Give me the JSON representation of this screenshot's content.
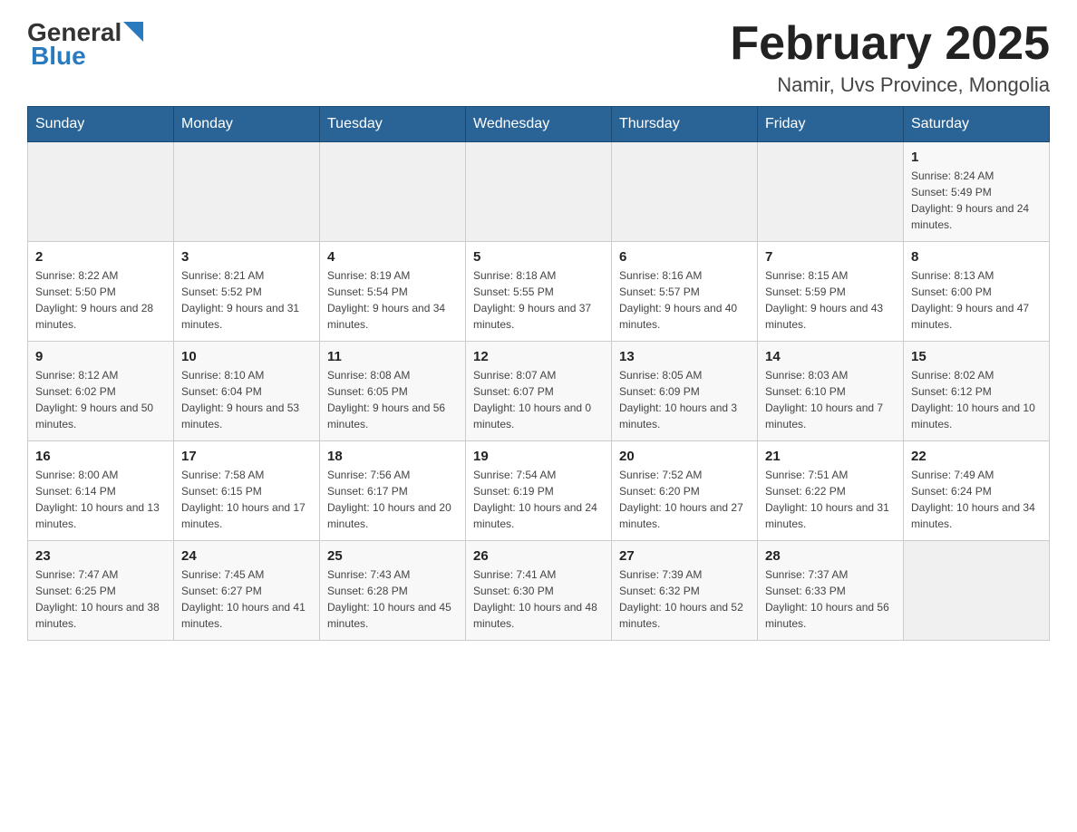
{
  "header": {
    "logo": {
      "general": "General",
      "arrow": "▶",
      "blue": "Blue"
    },
    "title": "February 2025",
    "location": "Namir, Uvs Province, Mongolia"
  },
  "weekdays": [
    "Sunday",
    "Monday",
    "Tuesday",
    "Wednesday",
    "Thursday",
    "Friday",
    "Saturday"
  ],
  "weeks": [
    [
      {
        "day": "",
        "info": ""
      },
      {
        "day": "",
        "info": ""
      },
      {
        "day": "",
        "info": ""
      },
      {
        "day": "",
        "info": ""
      },
      {
        "day": "",
        "info": ""
      },
      {
        "day": "",
        "info": ""
      },
      {
        "day": "1",
        "info": "Sunrise: 8:24 AM\nSunset: 5:49 PM\nDaylight: 9 hours and 24 minutes."
      }
    ],
    [
      {
        "day": "2",
        "info": "Sunrise: 8:22 AM\nSunset: 5:50 PM\nDaylight: 9 hours and 28 minutes."
      },
      {
        "day": "3",
        "info": "Sunrise: 8:21 AM\nSunset: 5:52 PM\nDaylight: 9 hours and 31 minutes."
      },
      {
        "day": "4",
        "info": "Sunrise: 8:19 AM\nSunset: 5:54 PM\nDaylight: 9 hours and 34 minutes."
      },
      {
        "day": "5",
        "info": "Sunrise: 8:18 AM\nSunset: 5:55 PM\nDaylight: 9 hours and 37 minutes."
      },
      {
        "day": "6",
        "info": "Sunrise: 8:16 AM\nSunset: 5:57 PM\nDaylight: 9 hours and 40 minutes."
      },
      {
        "day": "7",
        "info": "Sunrise: 8:15 AM\nSunset: 5:59 PM\nDaylight: 9 hours and 43 minutes."
      },
      {
        "day": "8",
        "info": "Sunrise: 8:13 AM\nSunset: 6:00 PM\nDaylight: 9 hours and 47 minutes."
      }
    ],
    [
      {
        "day": "9",
        "info": "Sunrise: 8:12 AM\nSunset: 6:02 PM\nDaylight: 9 hours and 50 minutes."
      },
      {
        "day": "10",
        "info": "Sunrise: 8:10 AM\nSunset: 6:04 PM\nDaylight: 9 hours and 53 minutes."
      },
      {
        "day": "11",
        "info": "Sunrise: 8:08 AM\nSunset: 6:05 PM\nDaylight: 9 hours and 56 minutes."
      },
      {
        "day": "12",
        "info": "Sunrise: 8:07 AM\nSunset: 6:07 PM\nDaylight: 10 hours and 0 minutes."
      },
      {
        "day": "13",
        "info": "Sunrise: 8:05 AM\nSunset: 6:09 PM\nDaylight: 10 hours and 3 minutes."
      },
      {
        "day": "14",
        "info": "Sunrise: 8:03 AM\nSunset: 6:10 PM\nDaylight: 10 hours and 7 minutes."
      },
      {
        "day": "15",
        "info": "Sunrise: 8:02 AM\nSunset: 6:12 PM\nDaylight: 10 hours and 10 minutes."
      }
    ],
    [
      {
        "day": "16",
        "info": "Sunrise: 8:00 AM\nSunset: 6:14 PM\nDaylight: 10 hours and 13 minutes."
      },
      {
        "day": "17",
        "info": "Sunrise: 7:58 AM\nSunset: 6:15 PM\nDaylight: 10 hours and 17 minutes."
      },
      {
        "day": "18",
        "info": "Sunrise: 7:56 AM\nSunset: 6:17 PM\nDaylight: 10 hours and 20 minutes."
      },
      {
        "day": "19",
        "info": "Sunrise: 7:54 AM\nSunset: 6:19 PM\nDaylight: 10 hours and 24 minutes."
      },
      {
        "day": "20",
        "info": "Sunrise: 7:52 AM\nSunset: 6:20 PM\nDaylight: 10 hours and 27 minutes."
      },
      {
        "day": "21",
        "info": "Sunrise: 7:51 AM\nSunset: 6:22 PM\nDaylight: 10 hours and 31 minutes."
      },
      {
        "day": "22",
        "info": "Sunrise: 7:49 AM\nSunset: 6:24 PM\nDaylight: 10 hours and 34 minutes."
      }
    ],
    [
      {
        "day": "23",
        "info": "Sunrise: 7:47 AM\nSunset: 6:25 PM\nDaylight: 10 hours and 38 minutes."
      },
      {
        "day": "24",
        "info": "Sunrise: 7:45 AM\nSunset: 6:27 PM\nDaylight: 10 hours and 41 minutes."
      },
      {
        "day": "25",
        "info": "Sunrise: 7:43 AM\nSunset: 6:28 PM\nDaylight: 10 hours and 45 minutes."
      },
      {
        "day": "26",
        "info": "Sunrise: 7:41 AM\nSunset: 6:30 PM\nDaylight: 10 hours and 48 minutes."
      },
      {
        "day": "27",
        "info": "Sunrise: 7:39 AM\nSunset: 6:32 PM\nDaylight: 10 hours and 52 minutes."
      },
      {
        "day": "28",
        "info": "Sunrise: 7:37 AM\nSunset: 6:33 PM\nDaylight: 10 hours and 56 minutes."
      },
      {
        "day": "",
        "info": ""
      }
    ]
  ],
  "colors": {
    "header_bg": "#2a6496",
    "header_text": "#ffffff",
    "border": "#cccccc",
    "row_odd": "#f8f8f8",
    "row_even": "#ffffff",
    "empty": "#f0f0f0"
  }
}
